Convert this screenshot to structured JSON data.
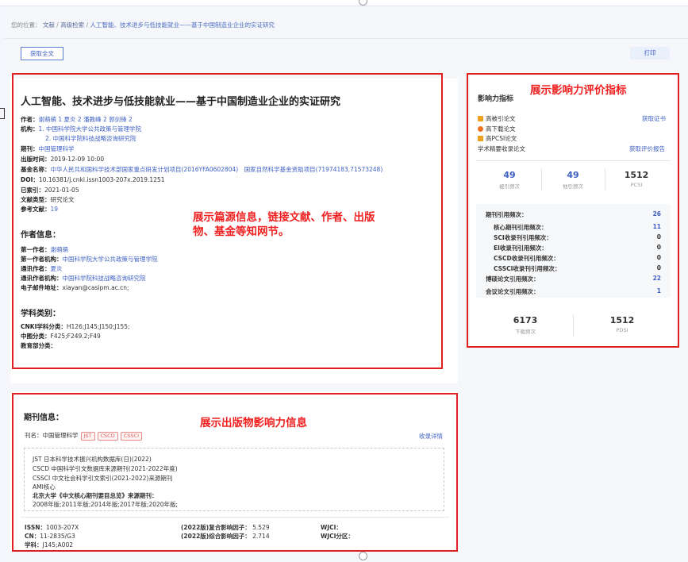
{
  "breadcrumb": {
    "prefix": "您的位置：",
    "items": [
      "文献",
      "高级检索"
    ],
    "current": "人工智能、技术进步与低技能就业——基于中国制造业企业的实证研究"
  },
  "toolbar": {
    "fulltext_label": "获取全文",
    "print_label": "打印"
  },
  "article": {
    "title": "人工智能、技术进步与低技能就业——基于中国制造业企业的实证研究",
    "authors_label": "作者：",
    "authors": [
      "谢萌萌 1",
      "夏炎 2",
      "潘教峰 2",
      "郭剑锋 2"
    ],
    "org_label": "机构：",
    "orgs": [
      "1. 中国科学院大学公共政策与管理学院",
      "2. 中国科学院科技战略咨询研究院"
    ],
    "journal_label": "期刊：",
    "journal": "中国管理科学",
    "date_label": "出版时间：",
    "date": "2019-12-09 10:00",
    "fund_label": "基金名称：",
    "fund": "中华人民共和国科学技术部国家重点研发计划项目(2016YFA0602804)　国家自然科学基金资助项目(71974183,71573248)",
    "doi_label": "DOI：",
    "doi": "10.16381/j.cnki.issn1003-207x.2019.1251",
    "cited_label": "已索引：",
    "cited": "2021-01-05",
    "type_label": "文献类型：",
    "type": "研究论文",
    "refs_label": "参考文献：",
    "refs": "19"
  },
  "author_info": {
    "heading": "作者信息：",
    "first_author_label": "第一作者：",
    "first_author": "谢萌萌",
    "first_org_label": "第一作者机构：",
    "first_org": "中国科学院大学公共政策与管理学院",
    "corr_label": "通讯作者：",
    "corr": "夏炎",
    "corr_org_label": "通讯作者机构：",
    "corr_org": "中国科学院科技战略咨询研究院",
    "email_label": "电子邮件地址：",
    "email": "xiayan@casipm.ac.cn;"
  },
  "subject": {
    "heading": "学科类别：",
    "cnki_label": "CNKI学科分类：",
    "cnki": "H126;J145;J150;J155;",
    "china_label": "中图分类：",
    "china": "F425;F249.2;F49",
    "edu_label": "教育部分类："
  },
  "annotations": {
    "left": "展示篇源信息，链接文献、作者、出版物、基金等知网节。",
    "right": "展示影响力评价指标",
    "bottom": "展示出版物影响力信息"
  },
  "impact": {
    "title": "影响力指标",
    "badges": [
      {
        "icon": "trophy-icon",
        "label": "高被引论文",
        "color": "#f0a020"
      },
      {
        "icon": "star-icon",
        "label": "高下载论文",
        "color": "#f07020"
      },
      {
        "icon": "crown-icon",
        "label": "高PCSI论文",
        "color": "#f0a020"
      }
    ],
    "extra": "学术精要收录论文",
    "cert_link": "获取证书",
    "report_link": "获取评价报告",
    "stats1": [
      {
        "value": "49",
        "label": "被引频次",
        "color": "#3d5fc4"
      },
      {
        "value": "49",
        "label": "他引频次",
        "color": "#3d5fc4"
      },
      {
        "value": "1512",
        "label": "PCSI",
        "color": "#222"
      }
    ],
    "citations": [
      {
        "label": "期刊引用频次：",
        "value": "26",
        "indent": false,
        "link": true
      },
      {
        "label": "核心期刊引用频次：",
        "value": "11",
        "indent": true,
        "link": true
      },
      {
        "label": "SCI收录刊引用频次：",
        "value": "0",
        "indent": true,
        "link": false
      },
      {
        "label": "EI收录刊引用频次：",
        "value": "0",
        "indent": true,
        "link": false
      },
      {
        "label": "CSCD收录刊引用频次：",
        "value": "0",
        "indent": true,
        "link": false
      },
      {
        "label": "CSSCI收录刊引用频次：",
        "value": "0",
        "indent": true,
        "link": false
      },
      {
        "label": "博硕论文引用频次：",
        "value": "22",
        "indent": false,
        "link": true
      },
      {
        "label": "会议论文引用频次：",
        "value": "1",
        "indent": false,
        "link": true
      }
    ],
    "stats2": [
      {
        "value": "6173",
        "label": "下载频次"
      },
      {
        "value": "1512",
        "label": "PDSI"
      }
    ]
  },
  "journal_info": {
    "heading": "期刊信息：",
    "name_label": "刊名：",
    "name": "中国管理科学",
    "tags": [
      "JST",
      "CSCD",
      "CSSCI"
    ],
    "detail_link": "收录详情",
    "inclusions": [
      "JST 日本科学技术振兴机构数据库(日)(2022)",
      "CSCD 中国科学引文数据库来源期刊(2021-2022年度)",
      "CSSCI 中文社会科学引文索引(2021-2022)来源期刊",
      "AMI核心",
      "北京大学《中文核心期刊要目总览》来源期刊：",
      "2008年版;2011年版;2014年版;2017年版;2020年版;"
    ],
    "issn_label": "ISSN：",
    "issn": "1003-207X",
    "cn_label": "CN：",
    "cn": "11-2835/G3",
    "subj_label": "学科：",
    "subj": "J145;A002",
    "if1_label": "(2022版)复合影响因子：",
    "if1": "5.529",
    "if2_label": "(2022版)综合影响因子：",
    "if2": "2.714",
    "wjci_label": "WJCI：",
    "wjci_zone_label": "WJCI分区："
  }
}
